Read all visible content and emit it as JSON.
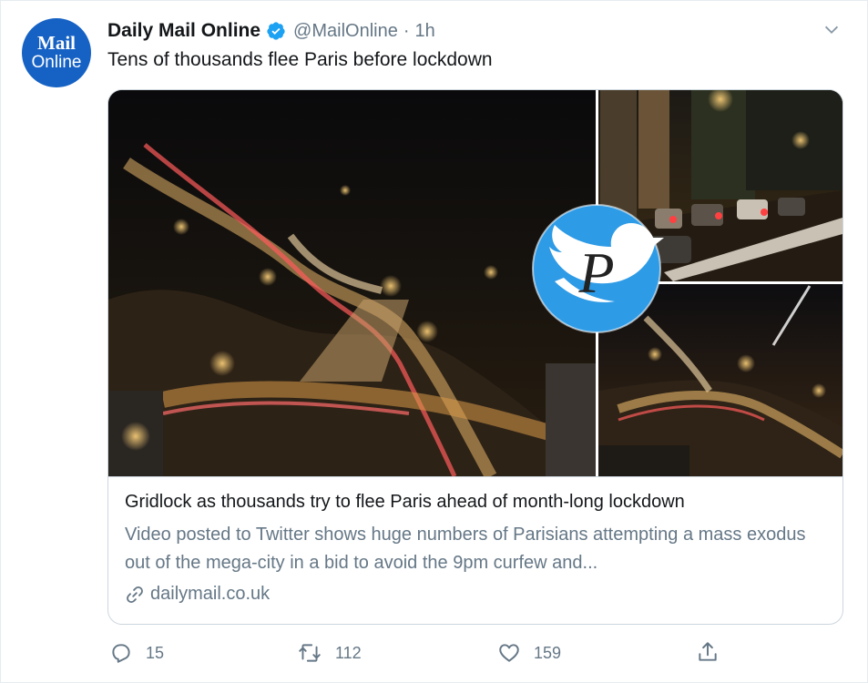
{
  "tweet": {
    "avatar": {
      "line1": "Mail",
      "line2": "Online",
      "color": "#1662c4"
    },
    "display_name": "Daily Mail Online",
    "handle": "@MailOnline",
    "separator": "·",
    "time": "1h",
    "text": "Tens of thousands flee Paris before lockdown",
    "icons": {
      "verified": "verified-badge-icon",
      "menu": "chevron-down-icon"
    }
  },
  "card": {
    "title": "Gridlock as thousands try to flee Paris ahead of month-long lockdown",
    "description": "Video posted to Twitter shows huge numbers of Parisians attempting a mass exodus out of the mega-city in a bid to avoid the 9pm curfew and...",
    "domain": "dailymail.co.uk",
    "media": {
      "watermark_letter": "P",
      "watermark_color": "#2e9be6",
      "images": [
        "night highway traffic aerial",
        "street traffic jam at night",
        "highway interchange at night"
      ]
    }
  },
  "actions": {
    "reply_count": "15",
    "retweet_count": "112",
    "like_count": "159",
    "icons": {
      "reply": "reply-icon",
      "retweet": "retweet-icon",
      "like": "heart-icon",
      "share": "share-icon"
    }
  },
  "colors": {
    "text": "#14171a",
    "secondary": "#657786",
    "border": "#ccd6dd",
    "accent": "#1da1f2"
  }
}
